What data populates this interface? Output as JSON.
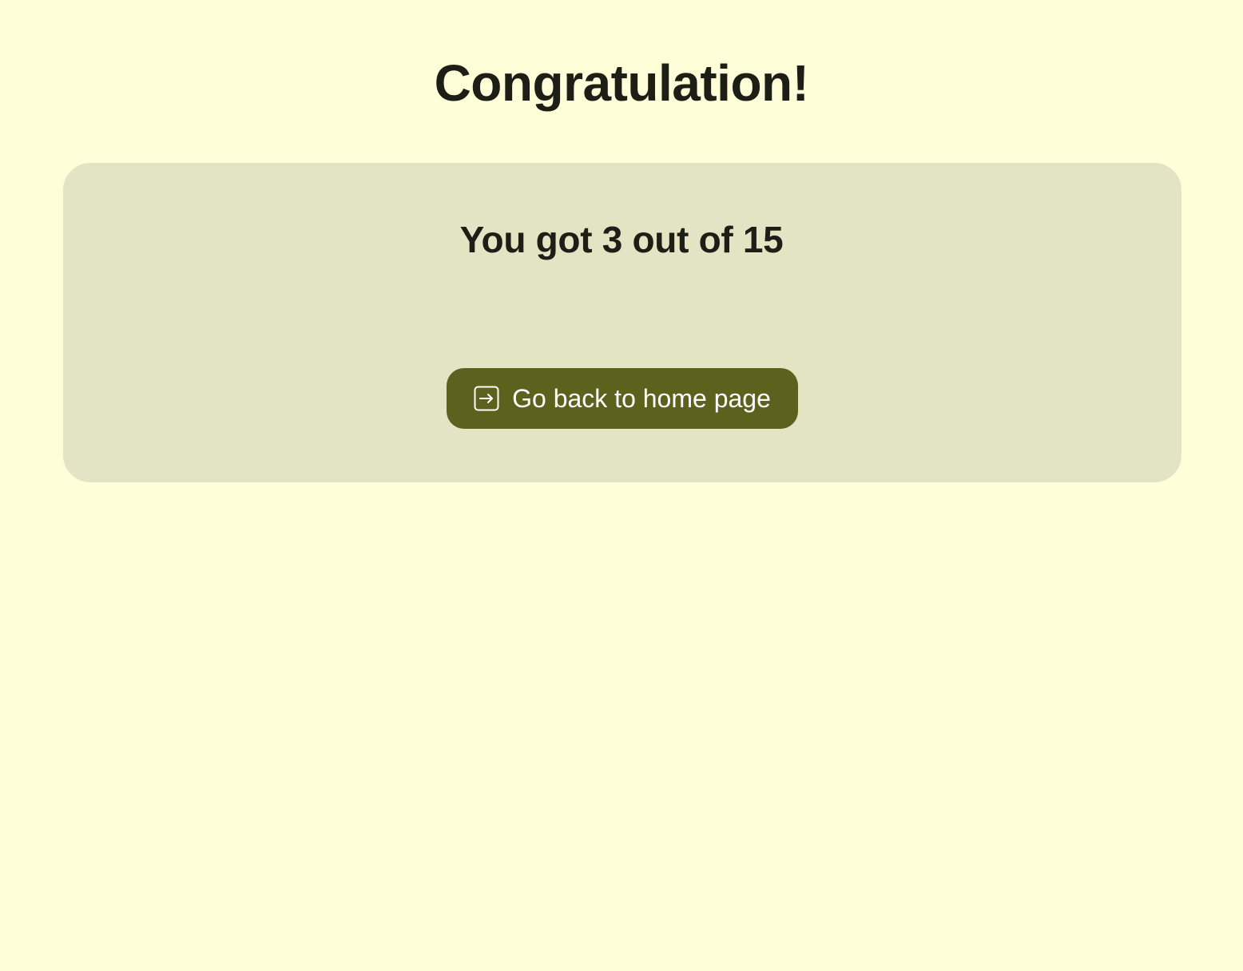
{
  "page": {
    "title": "Congratulation!",
    "background_color": "#feffd8"
  },
  "result": {
    "score_text": "You got 3 out of 15",
    "score": 3,
    "total": 15,
    "card_color": "#e3e4c4"
  },
  "home_button": {
    "label": "Go back to home page",
    "icon": "enter-arrow-square-icon",
    "color": "#5c621d",
    "text_color": "#ffffff"
  }
}
